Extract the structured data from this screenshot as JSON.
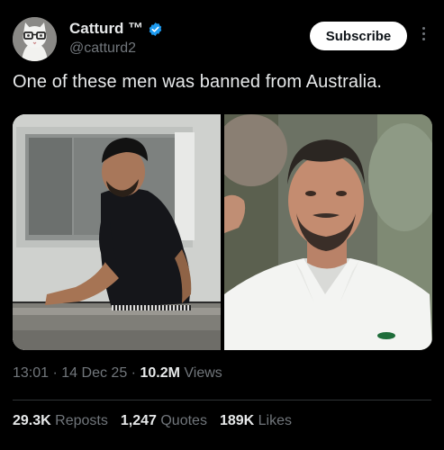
{
  "author": {
    "name": "Catturd ™",
    "handle": "@catturd2"
  },
  "actions": {
    "subscribe_label": "Subscribe"
  },
  "post": {
    "text": "One of these men was banned from Australia.",
    "time": "13:01",
    "date": "14 Dec 25",
    "views_count": "10.2M",
    "views_label": "Views",
    "separator": "·"
  },
  "stats": {
    "reposts_count": "29.3K",
    "reposts_label": "Reposts",
    "quotes_count": "1,247",
    "quotes_label": "Quotes",
    "likes_count": "189K",
    "likes_label": "Likes"
  },
  "colors": {
    "background": "#000000",
    "verified_badge": "#1d9bf0",
    "secondary_text": "#71767b"
  }
}
